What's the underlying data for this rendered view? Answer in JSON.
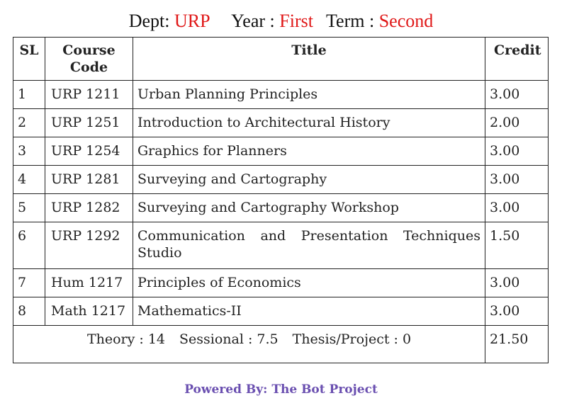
{
  "header": {
    "dept_label": "Dept:",
    "dept_value": "URP",
    "year_label": "Year :",
    "year_value": "First",
    "term_label": "Term :",
    "term_value": "Second"
  },
  "table": {
    "columns": [
      "SL",
      "Course Code",
      "Title",
      "Credit"
    ],
    "rows": [
      {
        "sl": "1",
        "code": "URP 1211",
        "title": "Urban Planning Principles",
        "credit": "3.00"
      },
      {
        "sl": "2",
        "code": "URP 1251",
        "title": "Introduction to Architectural History",
        "credit": "2.00"
      },
      {
        "sl": "3",
        "code": "URP 1254",
        "title": "Graphics for Planners",
        "credit": "3.00"
      },
      {
        "sl": "4",
        "code": "URP 1281",
        "title": "Surveying and Cartography",
        "credit": "3.00"
      },
      {
        "sl": "5",
        "code": "URP 1282",
        "title": "Surveying and Cartography Workshop",
        "credit": "3.00"
      },
      {
        "sl": "6",
        "code": "URP 1292",
        "title": "Communication and Presentation Techniques Studio",
        "credit": "1.50"
      },
      {
        "sl": "7",
        "code": "Hum 1217",
        "title": "Principles of Economics",
        "credit": "3.00"
      },
      {
        "sl": "8",
        "code": "Math 1217",
        "title": "Mathematics-II",
        "credit": "3.00"
      }
    ],
    "summary": {
      "theory": "Theory : 14",
      "sessional": "Sessional : 7.5",
      "thesis": "Thesis/Project : 0",
      "total_credit": "21.50"
    }
  },
  "footer": {
    "powered_by": "Powered By: The Bot Project"
  },
  "colors": {
    "accent_red": "#e01818",
    "footer_purple": "#6a4fb0",
    "border": "#222222"
  }
}
